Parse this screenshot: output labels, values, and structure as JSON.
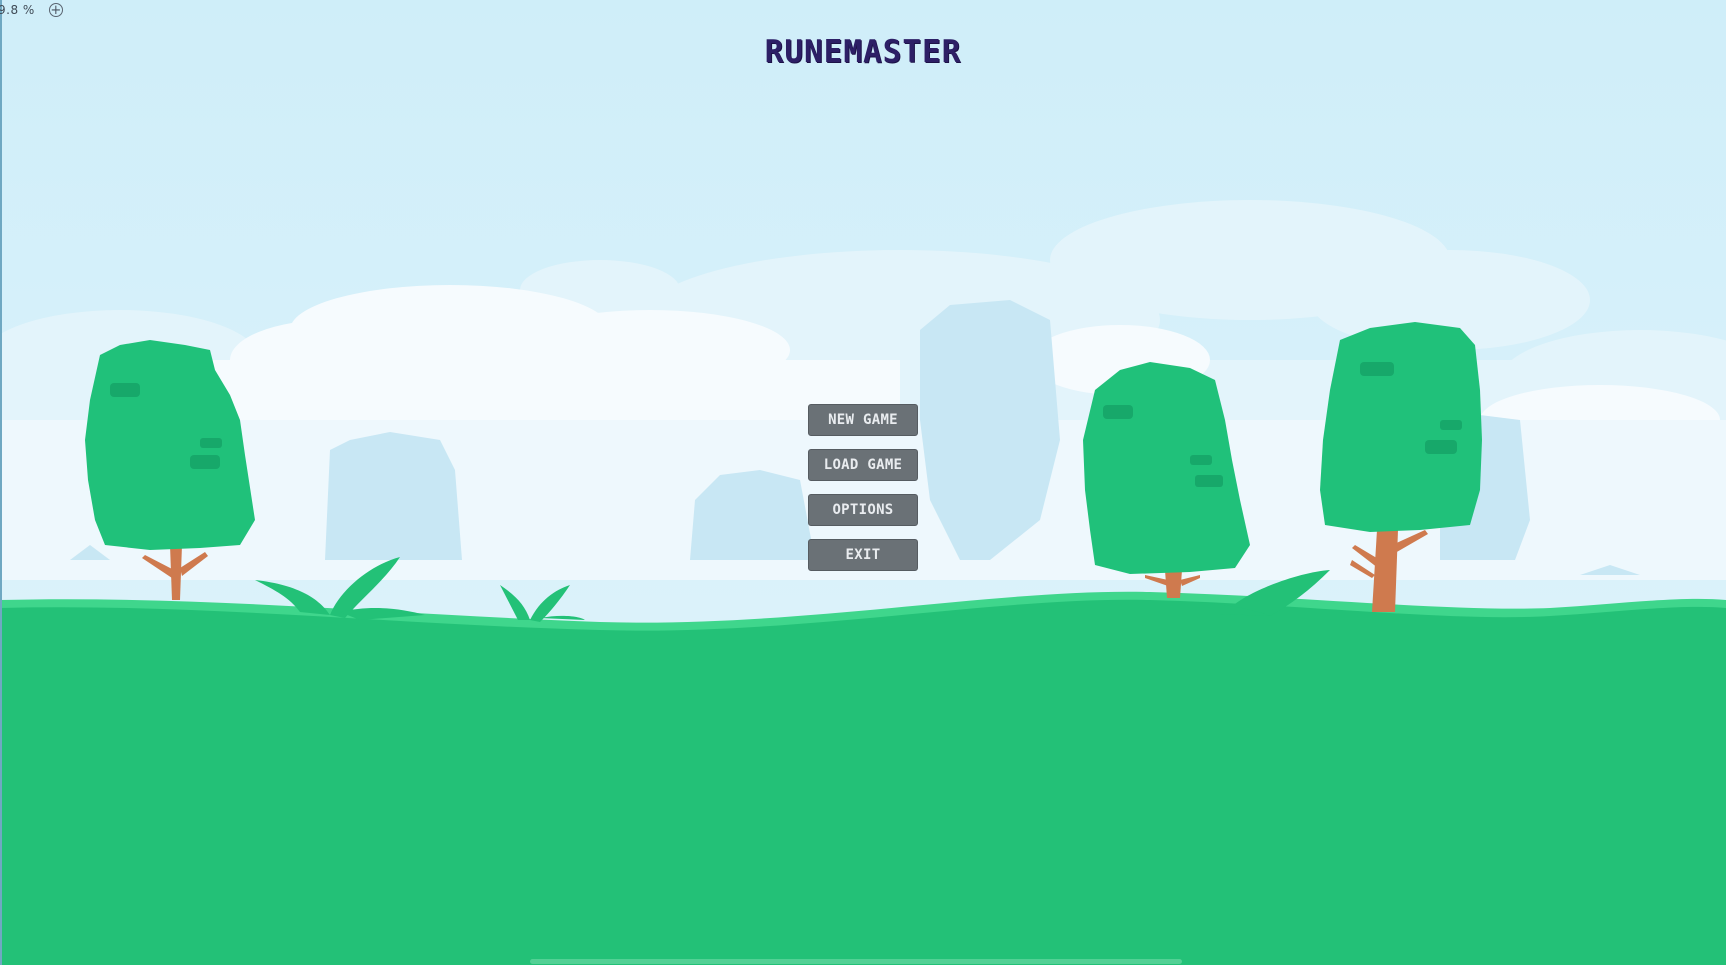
{
  "hud": {
    "zoom_text": "9.8 %",
    "zoom_icon": "plus-circle-icon"
  },
  "game": {
    "title": "RUNEMASTER"
  },
  "menu": {
    "new_game": "NEW GAME",
    "load_game": "LOAD GAME",
    "options": "OPTIONS",
    "exit": "EXIT"
  },
  "colors": {
    "sky": "#d4effa",
    "cloud": "#f4fbfe",
    "far_tree": "#c9e8f5",
    "grass": "#23c177",
    "grass_light": "#3fd68c",
    "tree_leaves": "#20c17a",
    "tree_trunk": "#cf7a4e",
    "title": "#2d1f66",
    "button": "#6a7176"
  }
}
